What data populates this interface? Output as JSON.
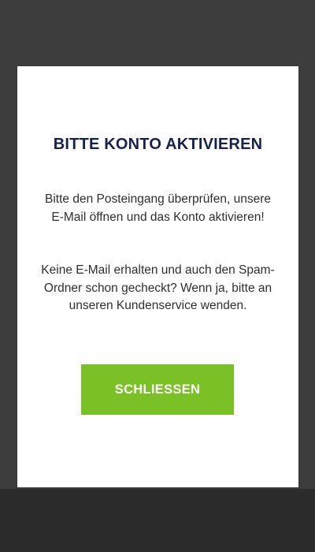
{
  "dialog": {
    "title": "BITTE KONTO AKTIVIEREN",
    "paragraph1": "Bitte den Posteingang überprüfen, unsere E-Mail öffnen und das Konto aktivieren!",
    "paragraph2": "Keine E-Mail erhalten und auch den Spam-Ordner schon gecheckt? Wenn ja, bitte an unseren Kundenservice wenden.",
    "close_label": "SCHLIESSEN"
  },
  "colors": {
    "overlay": "#3d3d3d",
    "title": "#16214d",
    "button": "#7ac125",
    "button_text": "#ffffff"
  }
}
